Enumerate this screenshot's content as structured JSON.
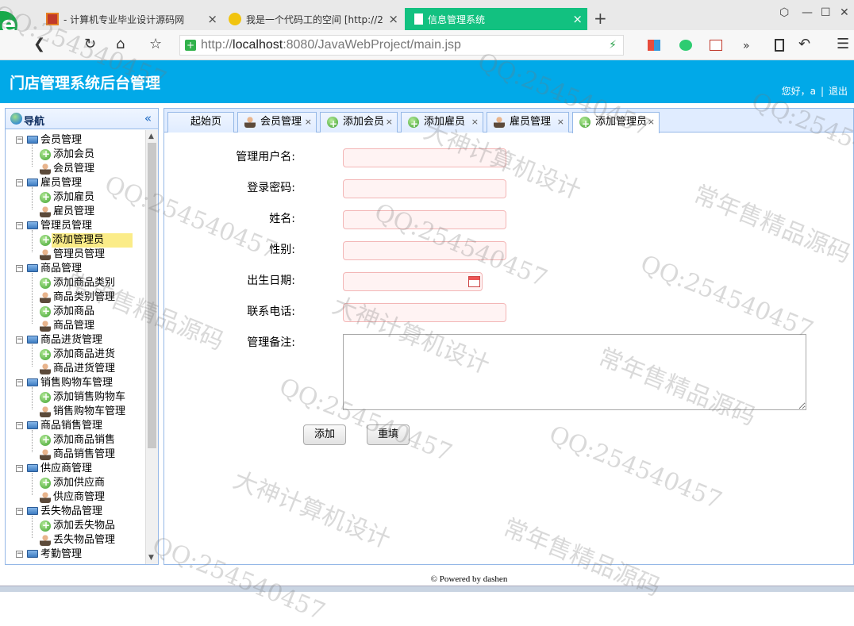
{
  "browser": {
    "tabs": [
      {
        "title": "- 计算机专业毕业设计源码网"
      },
      {
        "title": "我是一个代码工的空间 [http://2"
      },
      {
        "title": "信息管理系统"
      }
    ],
    "new_tab": "+",
    "address": {
      "prefix": "http://",
      "host": "localhost",
      "rest": ":8080/JavaWebProject/main.jsp"
    }
  },
  "app": {
    "title": "门店管理系统后台管理",
    "greeting": "您好，a",
    "logout": "退出"
  },
  "nav": {
    "title": "导航",
    "collapse": "«",
    "groups": [
      {
        "label": "会员管理",
        "items": [
          "添加会员",
          "会员管理"
        ]
      },
      {
        "label": "雇员管理",
        "items": [
          "添加雇员",
          "雇员管理"
        ]
      },
      {
        "label": "管理员管理",
        "items": [
          "添加管理员",
          "管理员管理"
        ]
      },
      {
        "label": "商品管理",
        "items": [
          "添加商品类别",
          "商品类别管理",
          "添加商品",
          "商品管理"
        ]
      },
      {
        "label": "商品进货管理",
        "items": [
          "添加商品进货",
          "商品进货管理"
        ]
      },
      {
        "label": "销售购物车管理",
        "items": [
          "添加销售购物车",
          "销售购物车管理"
        ]
      },
      {
        "label": "商品销售管理",
        "items": [
          "添加商品销售",
          "商品销售管理"
        ]
      },
      {
        "label": "供应商管理",
        "items": [
          "添加供应商",
          "供应商管理"
        ]
      },
      {
        "label": "丢失物品管理",
        "items": [
          "添加丢失物品",
          "丢失物品管理"
        ]
      },
      {
        "label": "考勤管理",
        "items": []
      }
    ],
    "selected": "添加管理员"
  },
  "tabs": [
    {
      "label": "起始页",
      "icon": "none",
      "closable": false
    },
    {
      "label": "会员管理",
      "icon": "user-icon",
      "closable": true
    },
    {
      "label": "添加会员",
      "icon": "add-icon",
      "closable": true
    },
    {
      "label": "添加雇员",
      "icon": "add-icon",
      "closable": true
    },
    {
      "label": "雇员管理",
      "icon": "user-icon",
      "closable": true
    },
    {
      "label": "添加管理员",
      "icon": "add-icon",
      "closable": true,
      "active": true
    }
  ],
  "tab_close": "×",
  "form": {
    "username_label": "管理用户名:",
    "password_label": "登录密码:",
    "name_label": "姓名:",
    "gender_label": "性别:",
    "birthday_label": "出生日期:",
    "phone_label": "联系电话:",
    "memo_label": "管理备注:",
    "username_value": "",
    "password_value": "",
    "name_value": "",
    "gender_value": "",
    "birthday_value": "",
    "phone_value": "",
    "memo_value": "",
    "submit_label": "添加",
    "reset_label": "重填"
  },
  "footer": "© Powered by dashen",
  "watermarks": [
    "QQ:254540457",
    "大神计算机设计",
    "常年售精品源码"
  ]
}
